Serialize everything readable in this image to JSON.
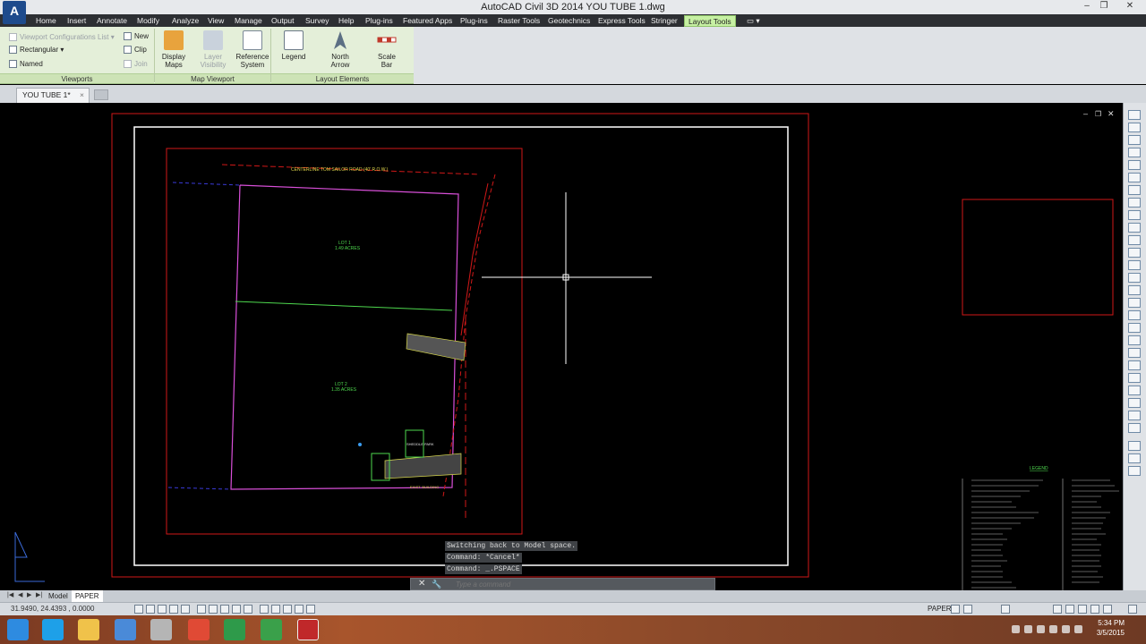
{
  "titlebar": {
    "title": "AutoCAD Civil 3D 2014    YOU TUBE 1.dwg",
    "app_letter": "A"
  },
  "tabs": [
    "Home",
    "Insert",
    "Annotate",
    "Modify",
    "Analyze",
    "View",
    "Manage",
    "Output",
    "Survey",
    "Help",
    "Plug-ins",
    "Featured Apps",
    "Plug-ins",
    "Raster Tools",
    "Geotechnics",
    "Express Tools",
    "Stringer",
    "Layout Tools"
  ],
  "active_tab": "Layout Tools",
  "ribbon": {
    "viewports": {
      "title": "Viewports",
      "config_list": "Viewport Configurations List",
      "rectangular": "Rectangular",
      "named": "Named",
      "new": "New",
      "clip": "Clip",
      "join": "Join"
    },
    "map_viewport": {
      "title": "Map Viewport",
      "display_maps": [
        "Display",
        "Maps"
      ],
      "layer_visibility": [
        "Layer",
        "Visibility"
      ],
      "reference_system": [
        "Reference",
        "System"
      ]
    },
    "layout_elements": {
      "title": "Layout Elements",
      "legend": "Legend",
      "north_arrow": [
        "North",
        "Arrow"
      ],
      "scale_bar": [
        "Scale",
        "Bar"
      ]
    }
  },
  "file_tab": {
    "label": "YOU TUBE 1*",
    "close": "×"
  },
  "drawing": {
    "centerline_label": "CENTERLINE TOM SAILOR ROAD (40' R.O.W.)",
    "lot1_top": [
      "LOT 1",
      "1.49 ACRES"
    ],
    "lot1_bottom": [
      "LOT 2",
      "1.35 ACRES"
    ],
    "legend_title": "LEGEND",
    "structure_label": "SHEDDLE PARK",
    "building_label": "EXIST. BUILDING"
  },
  "command": {
    "history": [
      "Switching back to Model space.",
      "Command: *Cancel*",
      "Command: _.PSPACE"
    ],
    "placeholder": "Type a command",
    "close": "✕",
    "wrench": "🔧"
  },
  "layout_tabs": [
    "Model",
    "PAPER"
  ],
  "active_layout": "PAPER",
  "status": {
    "coords": "31.9490,  24.4393 , 0.0000",
    "space": "PAPER"
  },
  "clock": {
    "time": "5:34 PM",
    "date": "3/5/2015"
  },
  "colors": {
    "accent": "#c6f0a2",
    "paper_border": "#ff0000",
    "viewport": "#ffffff"
  }
}
